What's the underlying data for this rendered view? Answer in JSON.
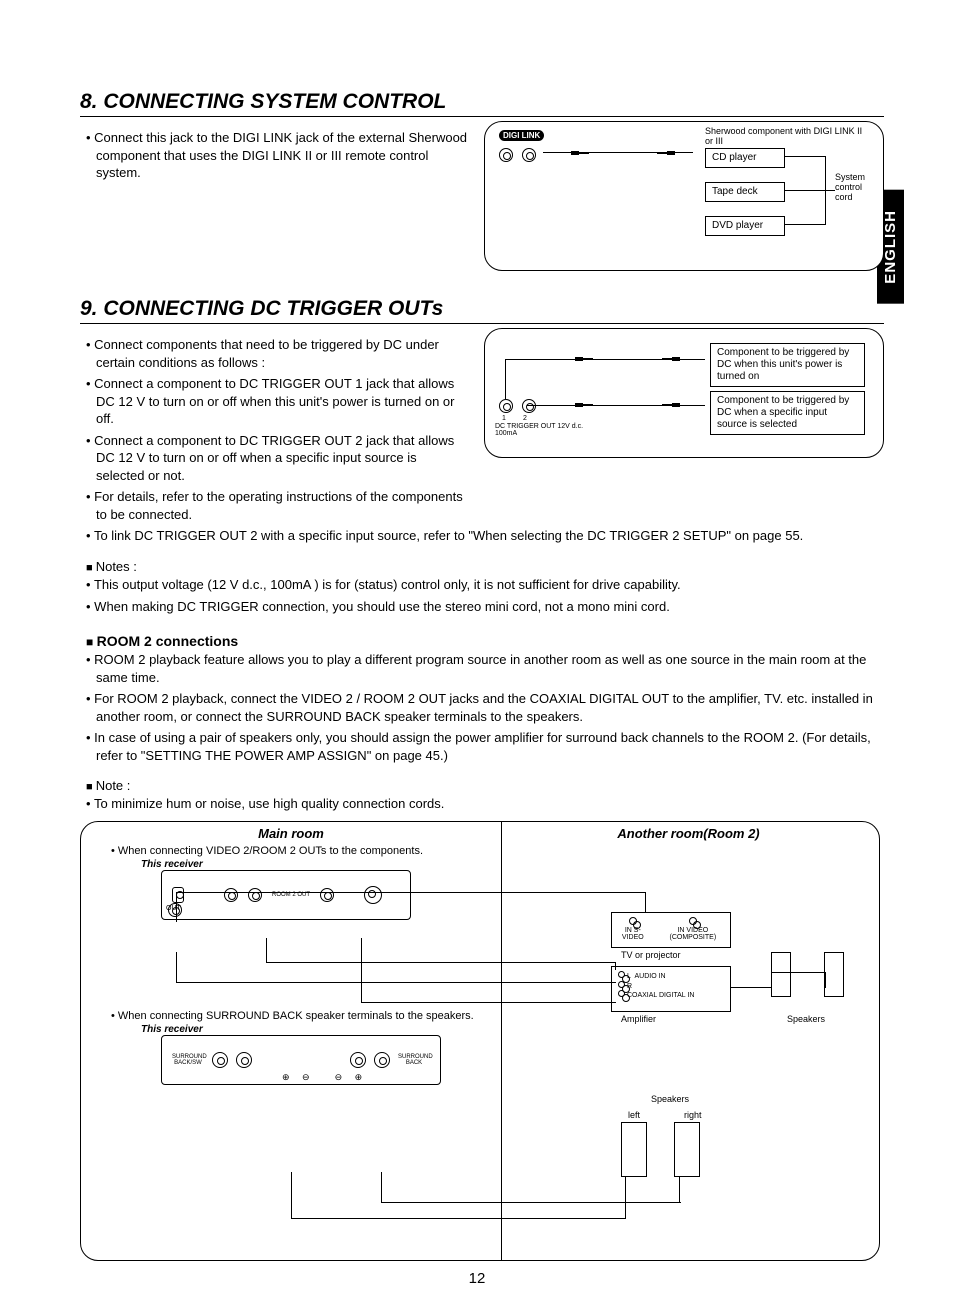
{
  "lang_tab": "ENGLISH",
  "page_number": "12",
  "section8": {
    "title": "8. CONNECTING SYSTEM CONTROL",
    "bullets": [
      "Connect this jack to the DIGI LINK jack of the external Sherwood component that uses the DIGI LINK II or III remote control system."
    ],
    "fig": {
      "digilink": "DIGI LINK",
      "header": "Sherwood component with DIGI LINK II or III",
      "items": [
        "CD player",
        "Tape deck",
        "DVD player"
      ],
      "side_label": "System control cord"
    }
  },
  "section9": {
    "title": "9. CONNECTING DC TRIGGER OUTs",
    "bullets_left": [
      "Connect components that need to be triggered by DC under certain conditions as follows :",
      "Connect a component to DC TRIGGER OUT 1 jack that allows DC 12 V to turn on or off when this unit's power is turned on or off.",
      "Connect a component to DC TRIGGER OUT 2 jack that allows DC 12 V to turn on or off when a specific input source is selected or not.",
      "For details, refer to the operating instructions of the components to be connected."
    ],
    "bullet_full": "To link DC TRIGGER OUT 2 with a specific input source, refer to \"When selecting the DC TRIGGER 2 SETUP\" on page 55.",
    "fig": {
      "jack_label_top": "1",
      "jack_label_top2": "2",
      "jack_caption": "DC TRIGGER OUT 12V d.c. 100mA",
      "box1": "Component to be triggered by DC when this unit's power is turned on",
      "box2": "Component to be triggered by DC when a specific input source is selected"
    },
    "notes_head": "Notes :",
    "notes": [
      "This output voltage (12 V d.c., 100mA ) is for (status) control only, it is not sufficient for drive capability.",
      "When making DC TRIGGER connection, you should use the stereo mini cord, not a mono mini cord."
    ],
    "room2_head": "ROOM 2 connections",
    "room2_bullets": [
      "ROOM 2 playback feature allows you to play a different program source in another room as well as one source in the main room at the same time.",
      "For ROOM 2 playback, connect the VIDEO 2 / ROOM 2 OUT jacks and the COAXIAL DIGITAL OUT to the amplifier, TV. etc. installed in another room, or connect the SURROUND BACK speaker terminals to the speakers.",
      "In case of using a pair of speakers only, you should assign the power amplifier for surround back channels to the ROOM 2. (For details, refer to \"SETTING THE POWER AMP ASSIGN\" on page 45.)"
    ],
    "note2_head": "Note :",
    "note2": [
      "To minimize hum or noise, use high quality connection cords."
    ],
    "fig_room": {
      "main_title": "Main room",
      "other_title": "Another room(Room 2)",
      "cap1": "When connecting VIDEO 2/ROOM 2 OUTs to the components.",
      "cap2": "When connecting SURROUND BACK speaker terminals to the speakers.",
      "this_receiver": "This receiver",
      "tv_label": "TV or projector",
      "tv_in1": "IN S-VIDEO",
      "tv_in2": "IN VIDEO (COMPOSITE)",
      "amp_label": "Amplifier",
      "amp_audio_l": "L",
      "amp_audio_r": "R",
      "amp_audio_in": "AUDIO IN",
      "amp_coax": "COAXIAL DIGITAL IN",
      "speakers_label": "Speakers",
      "speakers_label2": "Speakers",
      "left": "left",
      "right": "right",
      "sb_l": "SURROUND BACK/SW",
      "sb_r": "SURROUND BACK",
      "room2_out": "ROOM 2 OUT",
      "out": "OUT"
    }
  }
}
